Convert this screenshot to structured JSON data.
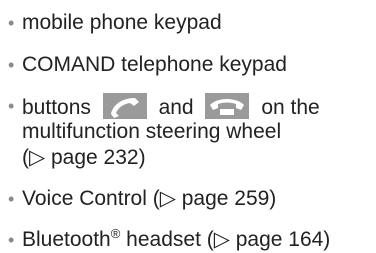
{
  "items": [
    {
      "text": "mobile phone keypad"
    },
    {
      "text": "COMAND telephone keypad"
    },
    {
      "part1": "buttons",
      "icon1": "phone-accept-icon",
      "part2": "and",
      "icon2": "phone-end-icon",
      "part3": "on the",
      "line2": "multifunction steering wheel",
      "line3": "(▷ page 232)"
    },
    {
      "text": "Voice Control (▷ page 259)"
    },
    {
      "pre": "Bluetooth",
      "reg": "®",
      "post": " headset (▷ page 164)"
    }
  ],
  "colors": {
    "text": "#222222",
    "bullet": "#8a8a8a",
    "icon_bg": "#9a9a9a",
    "icon_fg": "#ffffff"
  }
}
